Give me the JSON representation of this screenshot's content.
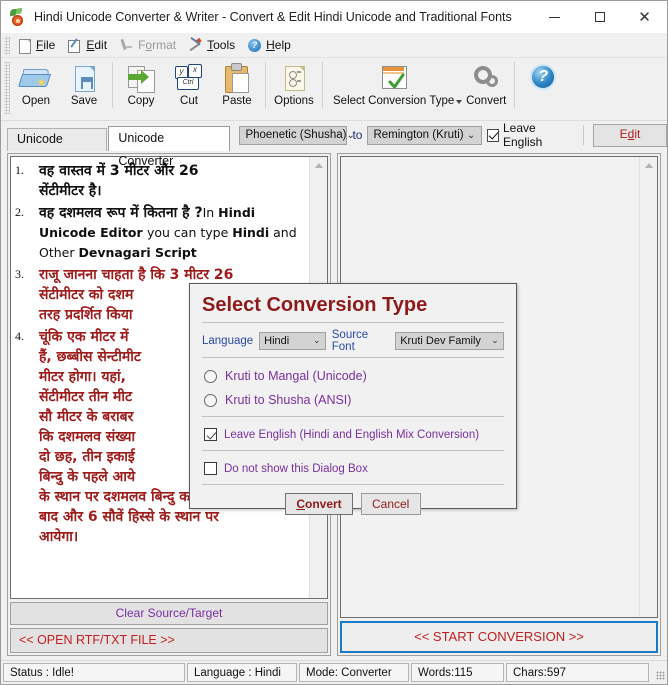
{
  "window": {
    "title": "Hindi Unicode Converter & Writer - Convert & Edit Hindi Unicode and Traditional Fonts",
    "icon": "app-gear-leaf-icon",
    "minimize": "—",
    "maximize": "□",
    "close": "✕"
  },
  "menu": [
    {
      "label": "File",
      "icon": "page-icon",
      "accel": "F",
      "disabled": false
    },
    {
      "label": "Edit",
      "icon": "pencil-icon",
      "accel": "E",
      "disabled": false
    },
    {
      "label": "Format",
      "icon": "format-pen-icon",
      "accel": "o",
      "disabled": true
    },
    {
      "label": "Tools",
      "icon": "hammer-wrench-icon",
      "accel": "T",
      "disabled": false
    },
    {
      "label": "Help",
      "icon": "help-circle-icon",
      "accel": "H",
      "disabled": false
    }
  ],
  "toolbar": {
    "open": "Open",
    "save": "Save",
    "copy": "Copy",
    "cut": "Cut",
    "cut_keys": {
      "y": "y",
      "x": "x",
      "ctrl": "Ctrl"
    },
    "paste": "Paste",
    "options": "Options",
    "select_conversion_type": "Select Conversion Type",
    "convert": "Convert",
    "help": "?"
  },
  "tabs": [
    {
      "label": "Unicode Editor",
      "active": false
    },
    {
      "label": "Unicode Converter",
      "active": true
    }
  ],
  "optionbar": {
    "source_font": "Phoenetic (Shusha)",
    "to_label": "to",
    "target_font": "Remington (Kruti)",
    "leave_english_label": "Leave English",
    "leave_english_checked": true,
    "edit_button": "Edit",
    "edit_button_accel": "d",
    "caret": "⌄"
  },
  "source_pane": {
    "items": [
      {
        "num": "1.",
        "color": "#101010",
        "lines": [
          "वह वास्तव में 3 मीटर और 26",
          "सेंटीमीटर है।"
        ]
      },
      {
        "num": "2.",
        "color": "#101010",
        "lines": [
          "वह दशमलव रूप में कितना है ?"
        ],
        "english_runs": [
          {
            "text": "In ",
            "bold": false
          },
          {
            "text": "Hindi Unicode Editor ",
            "bold": true
          },
          {
            "text": "you can type ",
            "bold": false
          },
          {
            "text": "Hindi",
            "bold": true
          },
          {
            "text": " and Other ",
            "bold": false
          },
          {
            "text": "Devnagari Script",
            "bold": true
          }
        ]
      },
      {
        "num": "3.",
        "color": "#9e1b1b",
        "lines": [
          "राजू जानना चाहता है कि 3 मीटर 26",
          "सेंटीमीटर को दशम",
          "तरह प्रदर्शित किया"
        ]
      },
      {
        "num": "4.",
        "color": "#9e1b1b",
        "lines": [
          "चूंकि एक मीटर में",
          "हैं, छब्बीस सेन्टीमीट",
          "मीटर होगा। यहां,",
          "सेंटीमीटर तीन मीट",
          "सौ मीटर के बराबर",
          "कि दशमलव संख्या",
          "दो छह, तीन इकाई",
          "बिन्दु के पहले आये",
          "के स्थान पर दशमलव बिन्दु क तुरंत",
          "बाद और 6 सौवें हिस्से के स्थान पर",
          "आयेगा।"
        ]
      }
    ],
    "clear_button": "Clear Source/Target",
    "open_file_button": "<< OPEN RTF/TXT FILE >>"
  },
  "target_pane": {
    "content": "",
    "start_button": "<< START CONVERSION >>"
  },
  "dialog": {
    "title": "Select Conversion Type",
    "language_label": "Language",
    "language_value": "Hindi",
    "source_font_label": "Source Font",
    "source_font_value": "Kruti Dev Family",
    "caret": "⌄",
    "options": [
      {
        "label": "Kruti to Mangal (Unicode)",
        "selected": false
      },
      {
        "label": "Kruti to Shusha (ANSI)",
        "selected": false
      }
    ],
    "leave_english": {
      "label": "Leave English (Hindi and English Mix Conversion)",
      "checked": true
    },
    "do_not_show": {
      "label": "Do not show this Dialog Box",
      "checked": false
    },
    "convert_button": "Convert",
    "convert_accel": "C",
    "cancel_button": "Cancel"
  },
  "statusbar": {
    "status": "Status :  Idle!",
    "language": "Language : Hindi",
    "mode": "Mode: Converter",
    "words": "Words:115",
    "chars": "Chars:597"
  },
  "colors": {
    "accent_blue": "#1a7ac4",
    "title_red": "#8e1b1b",
    "purple": "#7a2f9e",
    "red_text": "#c01f1f",
    "hindi_red": "#9e1b1b"
  }
}
